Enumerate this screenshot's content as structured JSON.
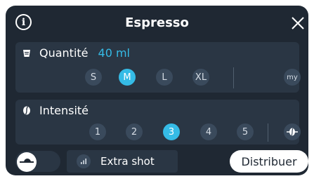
{
  "header": {
    "title": "Espresso",
    "info_icon": "info-icon",
    "close_icon": "close-icon"
  },
  "quantity": {
    "label": "Quantité",
    "value": "40 ml",
    "icon": "cup-icon",
    "sizes": [
      "S",
      "M",
      "L",
      "XL"
    ],
    "selected": "M",
    "custom_label": "my"
  },
  "intensity": {
    "label": "Intensité",
    "icon": "coffee-bean-icon",
    "levels": [
      "1",
      "2",
      "3",
      "4",
      "5"
    ],
    "selected": "3",
    "extra_icon": "bean-adjust-icon"
  },
  "bottom": {
    "toggle_icon": "lever-icon",
    "extra_shot_label": "Extra shot",
    "extra_shot_icon": "signal-bars-icon",
    "dispense_label": "Distribuer"
  },
  "colors": {
    "background": "#1f2833",
    "panel": "#2a3644",
    "accent": "#35bbe6",
    "inactive_circle": "#3a4a5c"
  }
}
